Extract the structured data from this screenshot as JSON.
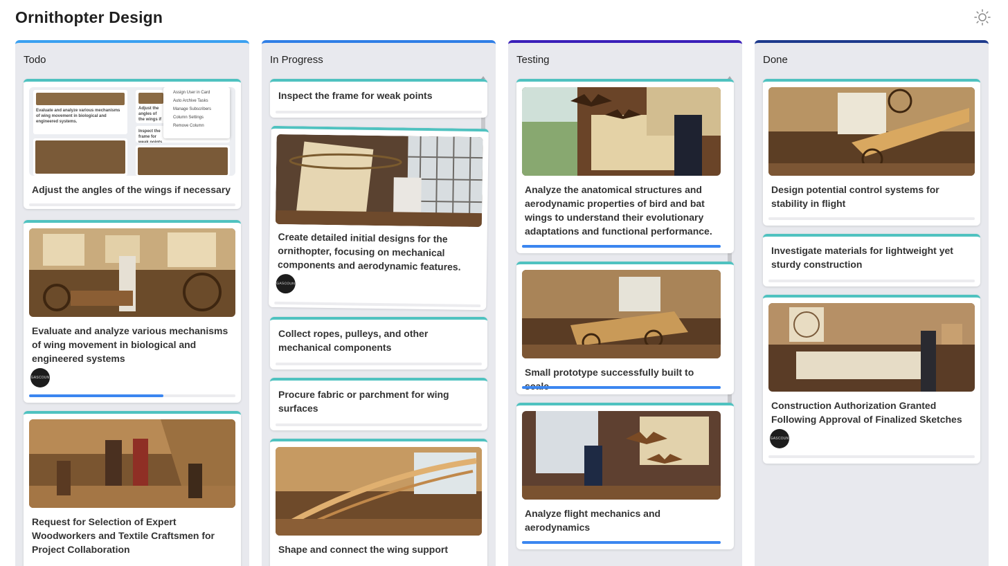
{
  "page": {
    "title": "Ornithopter Design",
    "theme_icon": "sun-icon"
  },
  "colors": {
    "todo": "#3aa0f0",
    "in_progress": "#2f7ee6",
    "testing": "#3a1fb8",
    "done": "#1d3a8c",
    "card_accent": "#4fc2c0",
    "progress": "#3b86f0"
  },
  "avatar_label": "GASCOUN",
  "preview_menu": [
    "Assign User in Card",
    "Auto Archive Tasks",
    "Manage Subscribers",
    "Column Settings",
    "Remove Column"
  ],
  "preview_texts": {
    "snippet_a": "Evaluate and analyze various mechanisms of wing movement in biological and engineered systems.",
    "snippet_b": "Adjust the angles of the wings if necessary",
    "snippet_c": "Inspect the frame for weak points"
  },
  "columns": [
    {
      "title": "Todo",
      "cards": [
        {
          "title": "Adjust the angles of the wings if necessary",
          "progress": 0
        },
        {
          "title": "Evaluate and analyze various mechanisms of wing movement in biological and engineered systems",
          "progress": 0.65
        },
        {
          "title": "Request for Selection of Expert Woodworkers and Textile Craftsmen for Project Collaboration",
          "progress": 0
        }
      ]
    },
    {
      "title": "In Progress",
      "cards": [
        {
          "title": "Inspect the frame for weak points",
          "progress": 0
        },
        {
          "title": "Create detailed initial designs for the ornithopter, focusing on mechanical components and aerodynamic features.",
          "progress": 0
        },
        {
          "title": "Collect ropes, pulleys, and other mechanical components",
          "progress": 0
        },
        {
          "title": "Procure fabric or parchment for wing surfaces",
          "progress": 0
        },
        {
          "title": "Shape and connect the wing support",
          "progress": 0
        }
      ]
    },
    {
      "title": "Testing",
      "cards": [
        {
          "title": "Analyze the anatomical structures and aerodynamic properties of bird and bat wings to understand their evolutionary adaptations and functional performance.",
          "progress": 1
        },
        {
          "title": "Small prototype successfully built to scale",
          "progress": 1
        },
        {
          "title": "Analyze flight mechanics and aerodynamics",
          "progress": 1
        }
      ]
    },
    {
      "title": "Done",
      "cards": [
        {
          "title": "Design potential control systems for stability in flight",
          "progress": 0
        },
        {
          "title": "Investigate materials for lightweight yet sturdy construction",
          "progress": 0
        },
        {
          "title": "Construction Authorization Granted Following Approval of Finalized Sketches",
          "progress": 0
        }
      ]
    }
  ]
}
